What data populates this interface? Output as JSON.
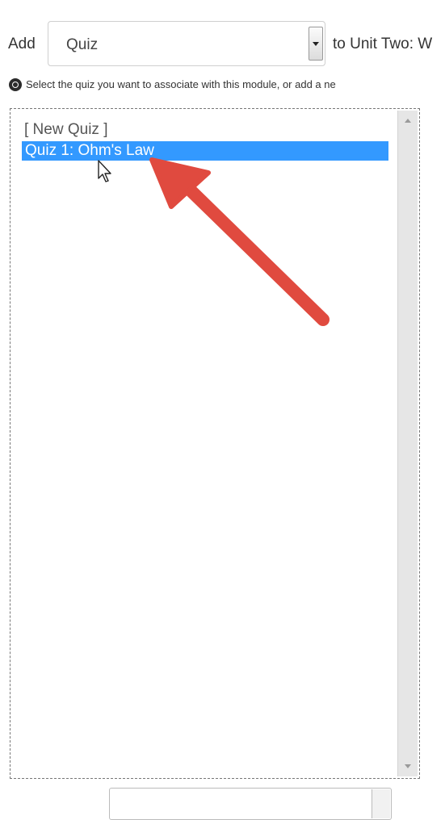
{
  "form": {
    "add_label": "Add",
    "content_type_value": "Quiz",
    "destination_label": "to Unit Two: W",
    "instruction": "Select the quiz you want to associate with this module, or add a ne"
  },
  "quiz_list": {
    "items": [
      {
        "label": "[ New Quiz ]",
        "selected": false
      },
      {
        "label": "Quiz 1: Ohm's Law",
        "selected": true
      }
    ]
  },
  "colors": {
    "selection": "#3399ff",
    "annotation_arrow": "#e04a3f"
  },
  "icons": {
    "instruction_icon": "radio-dot-icon",
    "cursor": "mouse-pointer-icon",
    "annotation": "red-arrow-annotation"
  }
}
